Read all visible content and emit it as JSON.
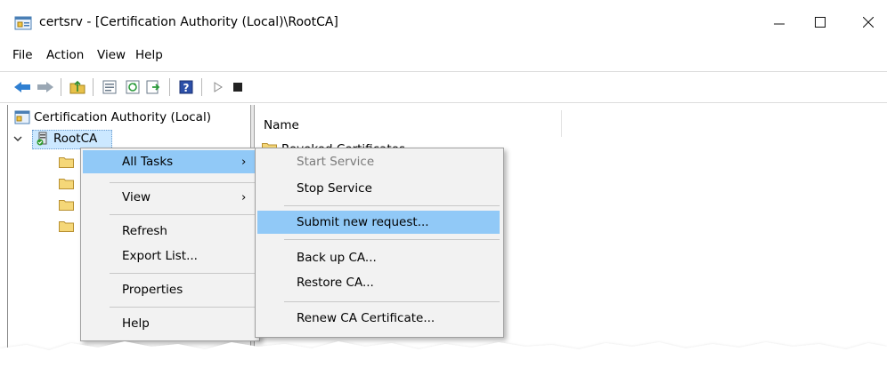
{
  "window": {
    "title": "certsrv - [Certification Authority (Local)\\RootCA]",
    "icon": "certsrv-icon",
    "controls": [
      "minimize-icon",
      "maximize-icon",
      "close-icon"
    ]
  },
  "menubar": [
    "File",
    "Action",
    "View",
    "Help"
  ],
  "toolbar": {
    "icons": [
      "back-arrow-icon",
      "forward-arrow-icon",
      "up-folder-icon",
      "properties-icon",
      "refresh-icon",
      "export-list-icon",
      "help-icon",
      "start-service-icon",
      "stop-service-icon"
    ]
  },
  "tree": {
    "root_label": "Certification Authority (Local)",
    "ca_label": "RootCA",
    "child_folders": 4
  },
  "list": {
    "column_name": "Name",
    "partial_item": "Revoked Certificates"
  },
  "context_menu": {
    "items": [
      "All Tasks",
      "View",
      "Refresh",
      "Export List...",
      "Properties",
      "Help"
    ],
    "submenu_arrow": "›"
  },
  "all_tasks_menu": {
    "items": [
      "Start Service",
      "Stop Service",
      "Submit new request...",
      "Back up CA...",
      "Restore CA...",
      "Renew CA Certificate..."
    ]
  },
  "colors": {
    "highlight": "#91c9f7",
    "menu_bg": "#f2f2f2",
    "tree_selection": "#cce8ff"
  }
}
